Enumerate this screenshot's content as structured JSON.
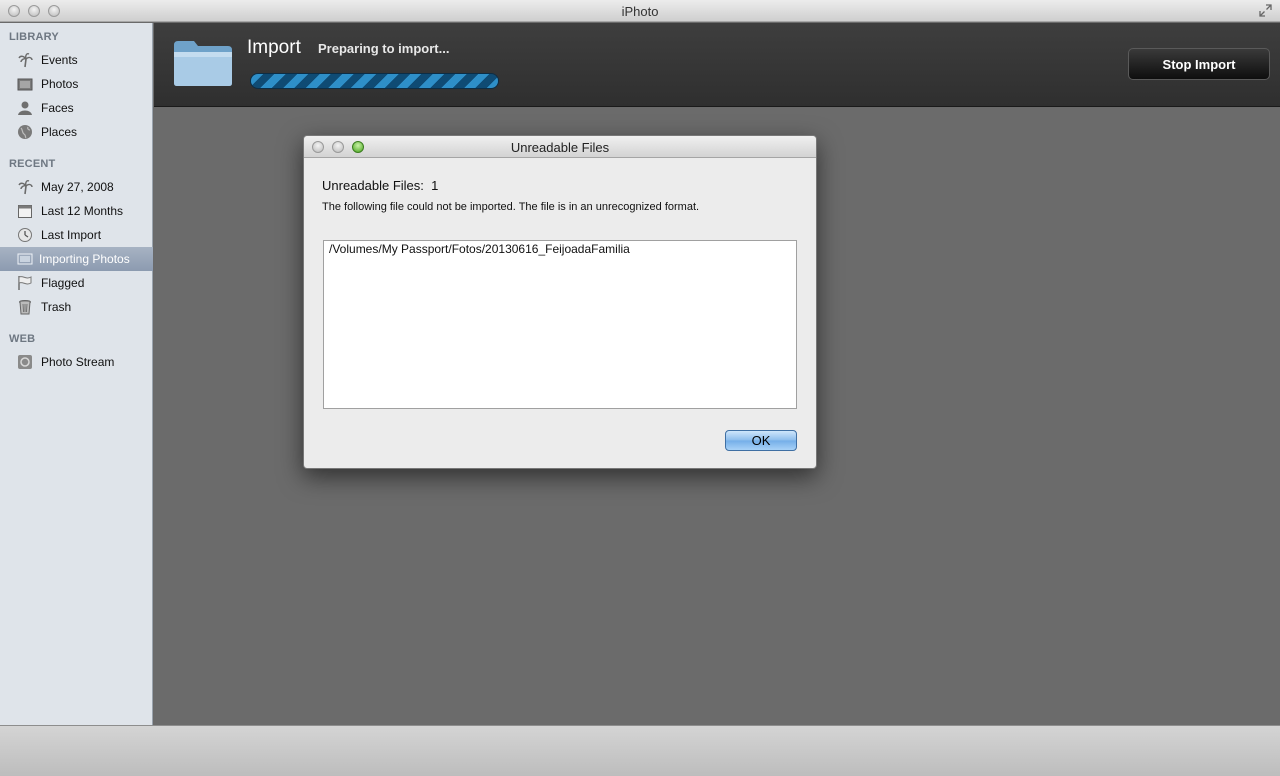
{
  "window": {
    "title": "iPhoto"
  },
  "sidebar": {
    "sections": [
      {
        "heading": "LIBRARY"
      },
      {
        "heading": "RECENT"
      },
      {
        "heading": "WEB"
      }
    ],
    "items": [
      {
        "label": "Events",
        "icon": "palm-tree-icon"
      },
      {
        "label": "Photos",
        "icon": "photos-icon"
      },
      {
        "label": "Faces",
        "icon": "faces-icon"
      },
      {
        "label": "Places",
        "icon": "globe-icon"
      },
      {
        "label": "May 27, 2008",
        "icon": "palm-tree-icon"
      },
      {
        "label": "Last 12 Months",
        "icon": "calendar-icon"
      },
      {
        "label": "Last Import",
        "icon": "clock-icon"
      },
      {
        "label": "Importing Photos",
        "icon": "import-icon",
        "selected": true
      },
      {
        "label": "Flagged",
        "icon": "flag-icon"
      },
      {
        "label": "Trash",
        "icon": "trash-icon"
      },
      {
        "label": "Photo Stream",
        "icon": "photo-stream-icon"
      }
    ]
  },
  "import_bar": {
    "title": "Import",
    "status": "Preparing to import...",
    "progress": 1.0,
    "stop_label": "Stop Import"
  },
  "dialog": {
    "title": "Unreadable Files",
    "heading": "Unreadable Files:  1",
    "message": "The following file could not be imported. The file is in an unrecognized format.",
    "files": [
      "/Volumes/My Passport/Fotos/20130616_FeijoadaFamilia"
    ],
    "ok_label": "OK"
  }
}
